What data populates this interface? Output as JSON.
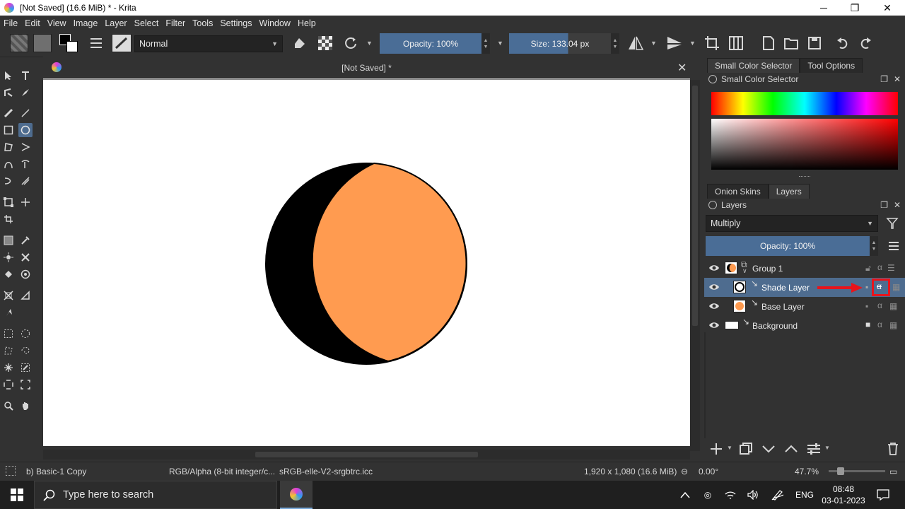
{
  "window": {
    "title": "[Not Saved]  (16.6 MiB)  * - Krita",
    "minimize_glyph": "─",
    "restore_glyph": "❐",
    "close_glyph": "✕"
  },
  "menu": [
    "File",
    "Edit",
    "View",
    "Image",
    "Layer",
    "Select",
    "Filter",
    "Tools",
    "Settings",
    "Window",
    "Help"
  ],
  "toolbar": {
    "blend_mode": "Normal",
    "opacity_label": "Opacity: 100%",
    "size_label": "Size: 133.04 px"
  },
  "document": {
    "tab_title": "[Not Saved]  *",
    "close_glyph": "✕"
  },
  "dock": {
    "color_tabs": [
      "Small Color Selector",
      "Tool Options"
    ],
    "color_panel_title": "Small Color Selector",
    "layer_tabs": [
      "Onion Skins",
      "Layers"
    ],
    "layers_panel_title": "Layers",
    "layers_blend_mode": "Multiply",
    "layers_opacity": "Opacity:  100%",
    "layers": [
      {
        "name": "Group 1",
        "selected": false,
        "thumb": "group"
      },
      {
        "name": "Shade Layer",
        "selected": true,
        "thumb": "shade"
      },
      {
        "name": "Base Layer",
        "selected": false,
        "thumb": "base"
      },
      {
        "name": "Background",
        "selected": false,
        "thumb": "white"
      }
    ]
  },
  "status": {
    "brush": "b) Basic-1 Copy",
    "colorspace": "RGB/Alpha (8-bit integer/c...",
    "profile": "sRGB-elle-V2-srgbtrc.icc",
    "dimensions": "1,920 x 1,080 (16.6 MiB)",
    "rotation": "0.00°",
    "zoom": "47.7%"
  },
  "taskbar": {
    "search_placeholder": "Type here to search",
    "language": "ENG",
    "time": "08:48",
    "date": "03-01-2023"
  },
  "colors": {
    "accent": "#4e6c8f",
    "shape_fill": "#ff9b50",
    "annotation_red": "#e8141b"
  }
}
